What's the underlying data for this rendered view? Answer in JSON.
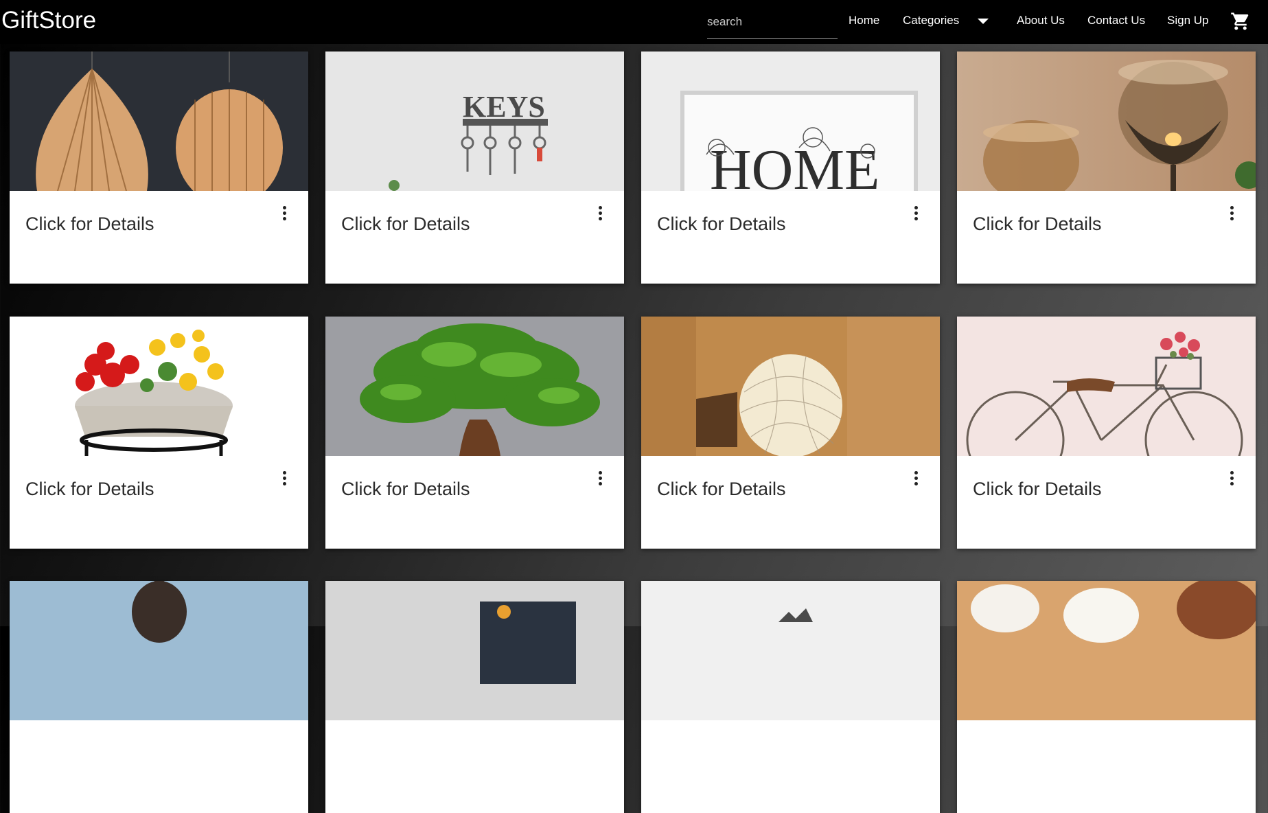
{
  "app": {
    "brand": "GiftStore"
  },
  "search": {
    "placeholder": "search"
  },
  "nav": {
    "home": "Home",
    "categories": "Categories",
    "about": "About Us",
    "contact": "Contact Us",
    "signup": "Sign Up"
  },
  "icons": {
    "cart": "shopping-cart-icon",
    "dropdown": "caret-down-icon",
    "more": "more-vert-icon"
  },
  "colors": {
    "navbar": "#000000",
    "card": "#ffffff",
    "text": "#2b2b2b"
  },
  "products": [
    {
      "title": "Click for Details",
      "image": "wooden pendant lamps"
    },
    {
      "title": "Click for Details",
      "image": "key holder",
      "image_text": "KEYS"
    },
    {
      "title": "Click for Details",
      "image": "framed home print",
      "image_text": "HOME"
    },
    {
      "title": "Click for Details",
      "image": "glass candle holders"
    },
    {
      "title": "Click for Details",
      "image": "flower planter"
    },
    {
      "title": "Click for Details",
      "image": "bonsai tree"
    },
    {
      "title": "Click for Details",
      "image": "glowing ball lamp"
    },
    {
      "title": "Click for Details",
      "image": "bicycle flower decor"
    },
    {
      "title": "",
      "image": "buddha statue"
    },
    {
      "title": "",
      "image": "wall art"
    },
    {
      "title": "",
      "image": "decor item"
    },
    {
      "title": "",
      "image": "tea cups"
    }
  ]
}
